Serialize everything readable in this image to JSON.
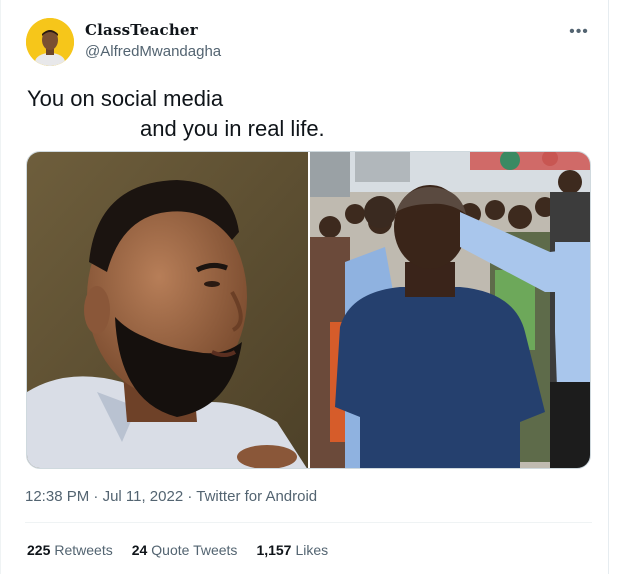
{
  "author": {
    "display_name": "ClassTeacher",
    "handle": "@AlfredMwandagha"
  },
  "menu_icon": "more-horizontal-icon",
  "tweet": {
    "line1": "You on social media",
    "line2": "and you in real life."
  },
  "media": {
    "left_photo": "portrait-photo",
    "right_photo": "crowd-photo"
  },
  "meta": {
    "time": "12:38 PM",
    "sep1": "·",
    "date": "Jul 11, 2022",
    "sep2": "·",
    "source": "Twitter for Android"
  },
  "stats": {
    "retweets_count": "225",
    "retweets_label": "Retweets",
    "quotes_count": "24",
    "quotes_label": "Quote Tweets",
    "likes_count": "1,157",
    "likes_label": "Likes"
  },
  "colors": {
    "text_primary": "#0f1419",
    "text_secondary": "#536471",
    "divider": "#eff3f4",
    "avatar_bg": "#f5c518"
  }
}
